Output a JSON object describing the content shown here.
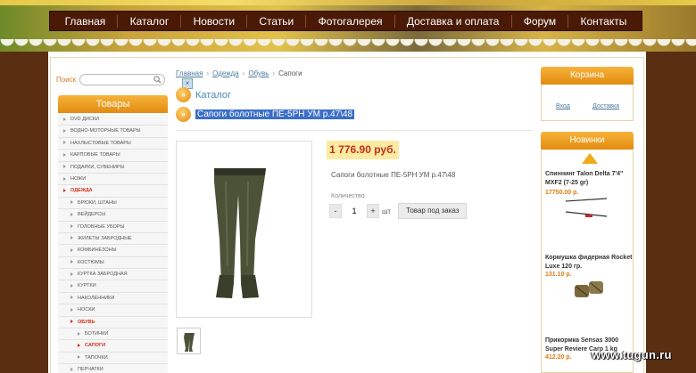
{
  "nav": {
    "items": [
      "Главная",
      "Каталог",
      "Новости",
      "Статьи",
      "Фотогалерея",
      "Доставка и оплата",
      "Форум",
      "Контакты"
    ]
  },
  "search": {
    "label": "Поиск",
    "value": ""
  },
  "sidebar": {
    "header": "Товары",
    "items": [
      {
        "label": "DVD ДИСКИ",
        "level": 0,
        "active": false
      },
      {
        "label": "ВОДНО-МОТОРНЫЕ ТОВАРЫ",
        "level": 0,
        "active": false
      },
      {
        "label": "НАХЛЫСТОВЫЕ ТОВАРЫ",
        "level": 0,
        "active": false
      },
      {
        "label": "КАРПОВЫЕ ТОВАРЫ",
        "level": 0,
        "active": false
      },
      {
        "label": "ПОДАРКИ, СУВЕНИРЫ",
        "level": 0,
        "active": false
      },
      {
        "label": "НОЖИ",
        "level": 0,
        "active": false
      },
      {
        "label": "ОДЕЖДА",
        "level": 0,
        "active": true
      },
      {
        "label": "БРЮКИ, ШТАНЫ",
        "level": 1,
        "active": false
      },
      {
        "label": "ВЕЙДЕРСЫ",
        "level": 1,
        "active": false
      },
      {
        "label": "ГОЛОВНЫЕ УБОРЫ",
        "level": 1,
        "active": false
      },
      {
        "label": "ЖИЛЕТЫ ЗАБРОДНЫЕ",
        "level": 1,
        "active": false
      },
      {
        "label": "КОМБИНЕЗОНЫ",
        "level": 1,
        "active": false
      },
      {
        "label": "КОСТЮМЫ",
        "level": 1,
        "active": false
      },
      {
        "label": "КУРТКА ЗАБРОДНАЯ",
        "level": 1,
        "active": false
      },
      {
        "label": "КУРТКИ",
        "level": 1,
        "active": false
      },
      {
        "label": "НАКОЛЕННИКИ",
        "level": 1,
        "active": false
      },
      {
        "label": "НОСКИ",
        "level": 1,
        "active": false
      },
      {
        "label": "ОБУВЬ",
        "level": 1,
        "active": true
      },
      {
        "label": "БОТИНКИ",
        "level": 2,
        "active": false
      },
      {
        "label": "САПОГИ",
        "level": 2,
        "active": true
      },
      {
        "label": "ТАПОЧКИ",
        "level": 2,
        "active": false
      },
      {
        "label": "ПЕРЧАТКИ",
        "level": 1,
        "active": false
      }
    ]
  },
  "breadcrumb": {
    "items": [
      "Главная",
      "Одежда",
      "Обувь"
    ],
    "current": "Сапоги"
  },
  "main": {
    "section_title": "Каталог",
    "product_title": "Сапоги болотные ПЕ-5РН УМ р.47\\48",
    "price": "1 776.90 руб.",
    "description": "Сапоги болотные ПЕ-5РН УМ  р.47\\48",
    "qty_label": "Количество",
    "qty_minus": "-",
    "qty_value": "1",
    "qty_plus": "+",
    "qty_unit": "шт",
    "order_button": "Товар под заказ",
    "close_icon": "×"
  },
  "cart": {
    "title": "Корзина",
    "login": "Вход",
    "delivery": "Доставка"
  },
  "new_products": {
    "title": "Новинки",
    "items": [
      {
        "name": "Спиннинг Talon Delta 7'4\" MXF2 (7-25 gr)",
        "price": "17750.00 р."
      },
      {
        "name": "Кормушка фидерная Rocket Luxe 120 гр.",
        "price": "131.10 р."
      },
      {
        "name": "Прикормка Sensas 3000 Super Reviere Carp 1 kg",
        "price": "412.20 р."
      }
    ]
  },
  "watermark": "www.tugun.ru",
  "colors": {
    "brand_orange": "#f2a91a",
    "nav_bg": "#4a1a06",
    "link_blue": "#4a7a9a",
    "active_red": "#d0301a",
    "price_bg": "#fbeaa2",
    "selection_blue": "#3a6ec8"
  }
}
